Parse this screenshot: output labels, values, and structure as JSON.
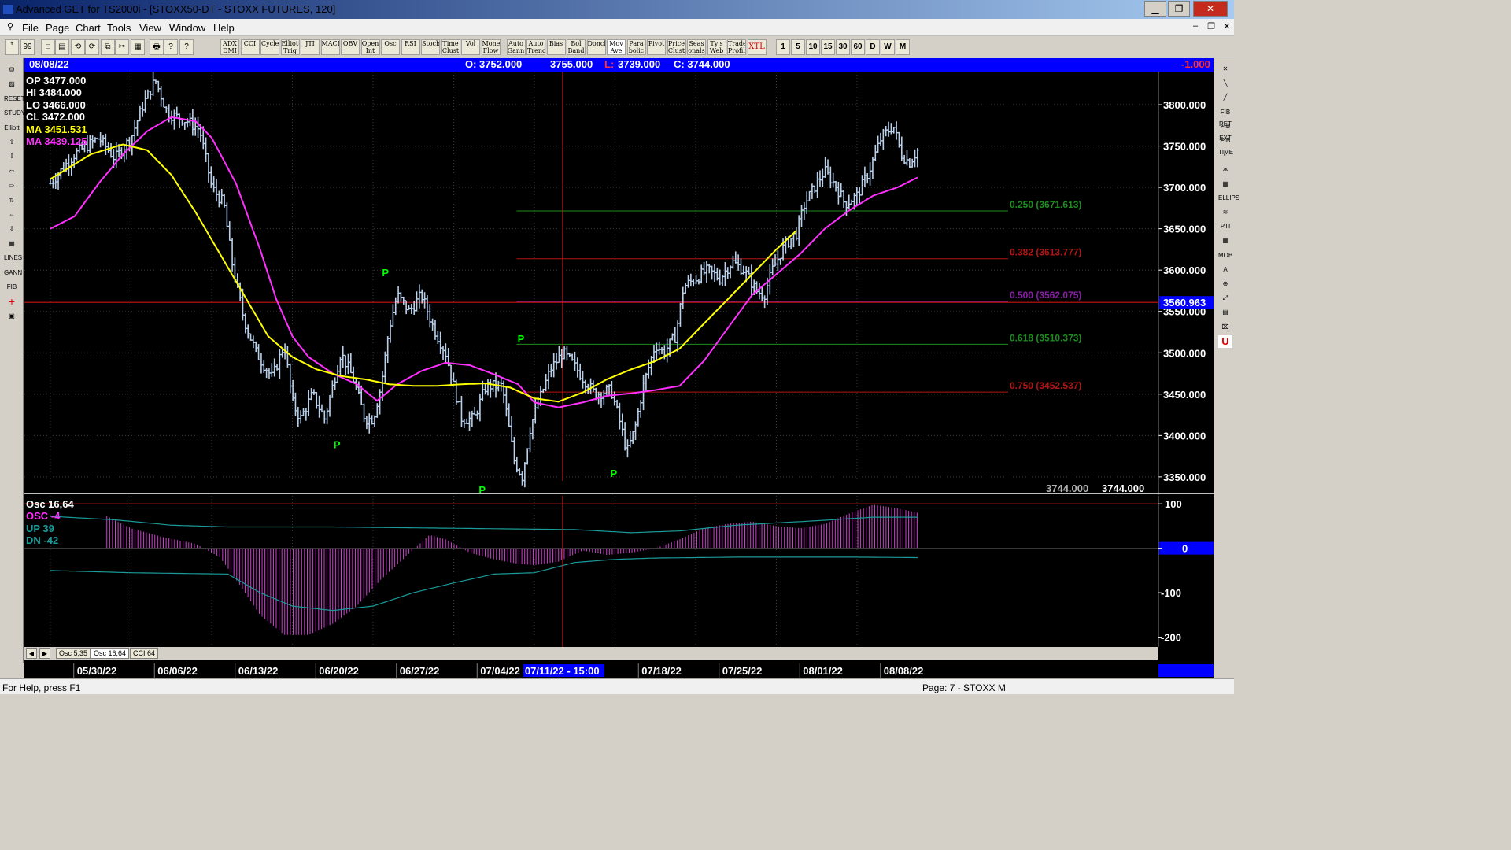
{
  "window": {
    "title": "Advanced GET for TS2000i - [STOXX50-DT - STOXX FUTURES, 120]",
    "minimize": "▁",
    "maximize": "❐",
    "close": "✕"
  },
  "menu": {
    "items": [
      "File",
      "Page",
      "Chart",
      "Tools",
      "View",
      "Window",
      "Help"
    ],
    "mdi_controls": [
      "–",
      "❐",
      "✕"
    ]
  },
  "toolbar": {
    "icon_buttons": [
      "ꜛ",
      "99",
      "□",
      "▤",
      "⟲",
      "⟳",
      "⧉",
      "✂",
      "▦",
      "🖶",
      "?",
      "?"
    ],
    "study_buttons": [
      "ADX DMI",
      "CCI",
      "Cycles",
      "Elliott Trig",
      "JTI",
      "MACD",
      "OBV",
      "Open Int",
      "Osc",
      "RSI",
      "Stoch",
      "Time Clust",
      "Vol",
      "Money Flow",
      "Auto Gann",
      "Auto Trend",
      "Bias",
      "Bol Band",
      "Donch",
      "Mov Ave",
      "Para bolic",
      "Pivot",
      "Price Clust",
      "Seas onals",
      "Ty's Web",
      "Trade Profile",
      "XTL"
    ],
    "interval_buttons": [
      "1",
      "5",
      "10",
      "15",
      "30",
      "60",
      "D",
      "W",
      "M"
    ]
  },
  "left_tools": [
    "⛁",
    "▨",
    "RESET",
    "STUDY",
    "Elliott",
    "⇧",
    "⇩",
    "⇦",
    "⇨",
    "⇅",
    "⇔",
    "⇳",
    "▦",
    "LINES",
    "GANN",
    "FIB",
    "+",
    "▣"
  ],
  "right_tools": [
    "✕",
    "╲",
    "╱",
    "FIB RET",
    "FIB EXT",
    "FIB TIME",
    "◐",
    "⩕",
    "▦",
    "ELLIPS",
    "≋",
    "PTI",
    "▦",
    "MOB",
    "A",
    "⊕",
    "⤢",
    "▤",
    "⌧",
    "U"
  ],
  "infobar": {
    "date": "08/08/22",
    "open": "O: 3752.000",
    "high": "3755.000",
    "low_label": "L:",
    "low": "3739.000",
    "close": "C: 3744.000",
    "change": "-1.000"
  },
  "price_legend": {
    "op": "OP  3477.000",
    "hi": "HI   3484.000",
    "lo": "LO  3466.000",
    "cl": "CL  3472.000",
    "ma1": "MA  3451.531",
    "ma2": "MA  3439.125"
  },
  "colors": {
    "bars": "#b8d0ec",
    "ma_fast": "#ffff00",
    "ma_slow": "#ff30ff",
    "fib_green": "#1e8c1e",
    "fib_red": "#b41414",
    "fib_purple": "#8a1ea8",
    "pivot": "#00ff00",
    "osc_hist": "#d040d0",
    "osc_band": "#1a9a9a",
    "axis_text": "#ffffff",
    "cursor_line": "#c81414"
  },
  "chart_data": {
    "type": "candlestick",
    "symbol": "STOXX50-DT - STOXX FUTURES",
    "interval": "120",
    "y_ticks": [
      3800,
      3750,
      3700,
      3650,
      3600,
      3550,
      3500,
      3450,
      3400,
      3350
    ],
    "y_tick_labels": [
      "3800.000",
      "3750.000",
      "3700.000",
      "3650.000",
      "3600.000",
      "3550.000",
      "3500.000",
      "3450.000",
      "3400.000",
      "3350.000"
    ],
    "ylim": [
      3328,
      3840
    ],
    "x_labels": [
      "05/30/22",
      "06/06/22",
      "06/13/22",
      "06/20/22",
      "06/27/22",
      "07/04/22",
      "07/18/22",
      "07/25/22",
      "08/01/22",
      "08/08/22"
    ],
    "cursor_x_label": "07/11/22 - 15:00",
    "cursor_price_label": "3560.963",
    "cursor_price": 3560.963,
    "last_value_labels": [
      "3744.000",
      "3744.000"
    ],
    "fib_levels": [
      {
        "ratio_label": "0.250 (3671.613)",
        "price": 3671.613,
        "color": "#1e8c1e"
      },
      {
        "ratio_label": "0.382 (3613.777)",
        "price": 3613.777,
        "color": "#b41414"
      },
      {
        "ratio_label": "0.500 (3562.075)",
        "price": 3562.075,
        "color": "#8a1ea8"
      },
      {
        "ratio_label": "0.618 (3510.373)",
        "price": 3510.373,
        "color": "#1e8c1e"
      },
      {
        "ratio_label": "0.750 (3452.537)",
        "price": 3452.537,
        "color": "#b41414"
      }
    ],
    "pivots": [
      {
        "label": "P",
        "date_index": 4.15,
        "price": 3585,
        "pos": "above"
      },
      {
        "label": "P",
        "date_index": 3.55,
        "price": 3400,
        "pos": "below"
      },
      {
        "label": "P",
        "date_index": 5.35,
        "price": 3345,
        "pos": "below"
      },
      {
        "label": "P",
        "date_index": 5.83,
        "price": 3505,
        "pos": "above"
      },
      {
        "label": "P",
        "date_index": 6.98,
        "price": 3365,
        "pos": "below"
      }
    ],
    "price_path": [
      [
        0,
        3705
      ],
      [
        0.3,
        3740
      ],
      [
        0.6,
        3760
      ],
      [
        0.8,
        3735
      ],
      [
        1.0,
        3760
      ],
      [
        1.15,
        3800
      ],
      [
        1.3,
        3830
      ],
      [
        1.45,
        3790
      ],
      [
        1.7,
        3780
      ],
      [
        1.85,
        3770
      ],
      [
        2.0,
        3700
      ],
      [
        2.15,
        3680
      ],
      [
        2.25,
        3610
      ],
      [
        2.4,
        3540
      ],
      [
        2.55,
        3500
      ],
      [
        2.75,
        3470
      ],
      [
        2.9,
        3510
      ],
      [
        3.0,
        3440
      ],
      [
        3.1,
        3420
      ],
      [
        3.25,
        3450
      ],
      [
        3.4,
        3420
      ],
      [
        3.5,
        3460
      ],
      [
        3.6,
        3500
      ],
      [
        3.75,
        3470
      ],
      [
        3.9,
        3420
      ],
      [
        4.0,
        3420
      ],
      [
        4.1,
        3460
      ],
      [
        4.2,
        3530
      ],
      [
        4.3,
        3570
      ],
      [
        4.45,
        3550
      ],
      [
        4.6,
        3570
      ],
      [
        4.75,
        3530
      ],
      [
        4.9,
        3500
      ],
      [
        5.1,
        3420
      ],
      [
        5.25,
        3420
      ],
      [
        5.4,
        3460
      ],
      [
        5.6,
        3460
      ],
      [
        5.75,
        3370
      ],
      [
        5.85,
        3350
      ],
      [
        5.95,
        3410
      ],
      [
        6.05,
        3440
      ],
      [
        6.2,
        3480
      ],
      [
        6.35,
        3500
      ],
      [
        6.45,
        3490
      ],
      [
        6.6,
        3470
      ],
      [
        6.75,
        3450
      ],
      [
        6.95,
        3455
      ],
      [
        7.05,
        3420
      ],
      [
        7.15,
        3380
      ],
      [
        7.25,
        3410
      ],
      [
        7.35,
        3460
      ],
      [
        7.5,
        3510
      ],
      [
        7.6,
        3500
      ],
      [
        7.75,
        3520
      ],
      [
        7.85,
        3580
      ],
      [
        8.0,
        3590
      ],
      [
        8.15,
        3600
      ],
      [
        8.3,
        3590
      ],
      [
        8.45,
        3610
      ],
      [
        8.6,
        3600
      ],
      [
        8.75,
        3575
      ],
      [
        8.85,
        3570
      ],
      [
        8.95,
        3600
      ],
      [
        9.1,
        3630
      ],
      [
        9.25,
        3645
      ],
      [
        9.35,
        3680
      ],
      [
        9.5,
        3705
      ],
      [
        9.6,
        3720
      ],
      [
        9.75,
        3700
      ],
      [
        9.85,
        3680
      ],
      [
        10.0,
        3690
      ],
      [
        10.15,
        3720
      ],
      [
        10.3,
        3760
      ],
      [
        10.45,
        3775
      ],
      [
        10.55,
        3740
      ],
      [
        10.65,
        3730
      ],
      [
        10.75,
        3745
      ]
    ],
    "ma_fast_path": [
      [
        0,
        3710
      ],
      [
        0.5,
        3740
      ],
      [
        0.9,
        3752
      ],
      [
        1.2,
        3745
      ],
      [
        1.5,
        3715
      ],
      [
        1.8,
        3670
      ],
      [
        2.1,
        3620
      ],
      [
        2.4,
        3570
      ],
      [
        2.7,
        3520
      ],
      [
        3.0,
        3495
      ],
      [
        3.3,
        3480
      ],
      [
        3.6,
        3472
      ],
      [
        3.9,
        3468
      ],
      [
        4.2,
        3462
      ],
      [
        4.5,
        3460
      ],
      [
        4.8,
        3460
      ],
      [
        5.1,
        3462
      ],
      [
        5.4,
        3463
      ],
      [
        5.7,
        3458
      ],
      [
        6.0,
        3445
      ],
      [
        6.3,
        3441
      ],
      [
        6.6,
        3452
      ],
      [
        6.9,
        3468
      ],
      [
        7.2,
        3480
      ],
      [
        7.5,
        3490
      ],
      [
        7.8,
        3505
      ],
      [
        8.1,
        3535
      ],
      [
        8.4,
        3565
      ],
      [
        8.7,
        3595
      ],
      [
        9.0,
        3625
      ],
      [
        9.25,
        3648
      ]
    ],
    "ma_slow_path": [
      [
        0,
        3650
      ],
      [
        0.3,
        3665
      ],
      [
        0.6,
        3705
      ],
      [
        0.9,
        3740
      ],
      [
        1.2,
        3768
      ],
      [
        1.5,
        3785
      ],
      [
        1.8,
        3780
      ],
      [
        2.0,
        3760
      ],
      [
        2.3,
        3705
      ],
      [
        2.6,
        3625
      ],
      [
        2.8,
        3565
      ],
      [
        3.0,
        3520
      ],
      [
        3.2,
        3495
      ],
      [
        3.5,
        3475
      ],
      [
        3.8,
        3462
      ],
      [
        4.05,
        3442
      ],
      [
        4.3,
        3462
      ],
      [
        4.6,
        3478
      ],
      [
        4.9,
        3488
      ],
      [
        5.2,
        3485
      ],
      [
        5.5,
        3474
      ],
      [
        5.8,
        3462
      ],
      [
        6.0,
        3440
      ],
      [
        6.3,
        3434
      ],
      [
        6.6,
        3440
      ],
      [
        6.9,
        3448
      ],
      [
        7.2,
        3451
      ],
      [
        7.5,
        3455
      ],
      [
        7.8,
        3460
      ],
      [
        8.1,
        3490
      ],
      [
        8.4,
        3530
      ],
      [
        8.7,
        3570
      ],
      [
        9.0,
        3595
      ],
      [
        9.3,
        3620
      ],
      [
        9.6,
        3650
      ],
      [
        9.9,
        3672
      ],
      [
        10.2,
        3690
      ],
      [
        10.5,
        3700
      ],
      [
        10.75,
        3712
      ]
    ],
    "bar_count": 330
  },
  "osc_panel": {
    "legend": {
      "title": "Osc 16,64",
      "osc": "OSC -4",
      "up": "UP   39",
      "dn": "DN   -42"
    },
    "y_tick_labels": [
      "100",
      "0",
      "-100",
      "-200"
    ],
    "y_ticks": [
      100,
      0,
      -100,
      -200
    ],
    "ylim": [
      -222,
      118
    ],
    "zero_label": "0",
    "osc_path": [
      [
        0,
        80
      ],
      [
        0.4,
        88
      ],
      [
        0.7,
        72
      ],
      [
        1.0,
        45
      ],
      [
        1.4,
        25
      ],
      [
        1.8,
        10
      ],
      [
        2.1,
        -20
      ],
      [
        2.3,
        -70
      ],
      [
        2.6,
        -150
      ],
      [
        2.9,
        -195
      ],
      [
        3.2,
        -195
      ],
      [
        3.5,
        -170
      ],
      [
        3.8,
        -130
      ],
      [
        4.1,
        -70
      ],
      [
        4.4,
        -20
      ],
      [
        4.7,
        30
      ],
      [
        4.9,
        20
      ],
      [
        5.2,
        -10
      ],
      [
        5.5,
        -25
      ],
      [
        5.8,
        -35
      ],
      [
        6.0,
        -38
      ],
      [
        6.3,
        -30
      ],
      [
        6.6,
        -5
      ],
      [
        6.9,
        -15
      ],
      [
        7.2,
        -10
      ],
      [
        7.5,
        0
      ],
      [
        7.8,
        20
      ],
      [
        8.1,
        45
      ],
      [
        8.4,
        55
      ],
      [
        8.7,
        60
      ],
      [
        9.0,
        50
      ],
      [
        9.3,
        45
      ],
      [
        9.6,
        55
      ],
      [
        9.9,
        78
      ],
      [
        10.2,
        98
      ],
      [
        10.5,
        90
      ],
      [
        10.75,
        80
      ]
    ],
    "up_path": [
      [
        0,
        72
      ],
      [
        0.8,
        64
      ],
      [
        1.5,
        52
      ],
      [
        2.2,
        48
      ],
      [
        3.5,
        48
      ],
      [
        4.5,
        46
      ],
      [
        5.5,
        44
      ],
      [
        6.5,
        42
      ],
      [
        7.2,
        35
      ],
      [
        7.8,
        39
      ],
      [
        8.5,
        52
      ],
      [
        9.5,
        62
      ],
      [
        10.2,
        70
      ],
      [
        10.75,
        70
      ]
    ],
    "dn_path": [
      [
        0,
        -50
      ],
      [
        1.0,
        -55
      ],
      [
        2.2,
        -58
      ],
      [
        2.6,
        -100
      ],
      [
        3.0,
        -130
      ],
      [
        3.5,
        -140
      ],
      [
        4.0,
        -130
      ],
      [
        4.5,
        -100
      ],
      [
        5.0,
        -78
      ],
      [
        5.5,
        -58
      ],
      [
        6.0,
        -55
      ],
      [
        6.5,
        -32
      ],
      [
        7.0,
        -25
      ],
      [
        7.5,
        -22
      ],
      [
        8.5,
        -20
      ],
      [
        10.0,
        -20
      ],
      [
        10.75,
        -21
      ]
    ]
  },
  "tabs": [
    "Osc 5,35",
    "Osc 16,64",
    "CCI 64"
  ],
  "tab_nav": [
    "◀",
    "▶"
  ],
  "status": {
    "help": "For Help, press F1",
    "page": "Page: 7 - STOXX M"
  }
}
